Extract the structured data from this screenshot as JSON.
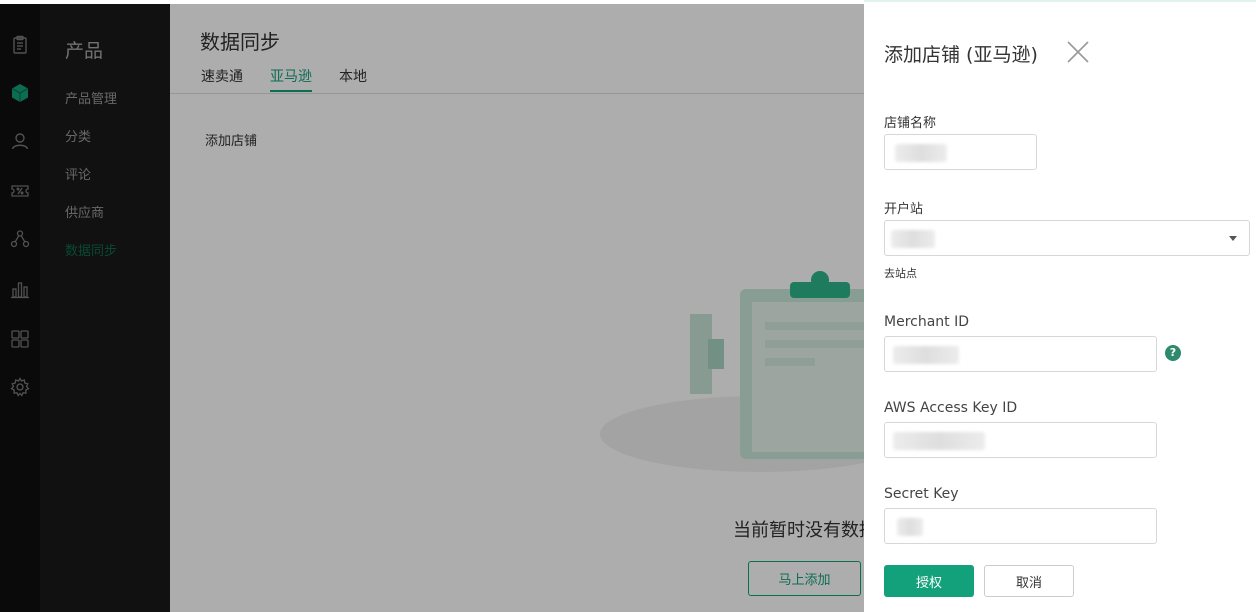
{
  "sidebar": {
    "title": "产品",
    "items": [
      {
        "label": "产品管理"
      },
      {
        "label": "分类"
      },
      {
        "label": "评论"
      },
      {
        "label": "供应商"
      },
      {
        "label": "数据同步",
        "active": true
      }
    ]
  },
  "rail": {
    "icons": [
      "clipboard-icon",
      "cube-icon",
      "user-icon",
      "discount-icon",
      "share-icon",
      "bar-chart-icon",
      "apps-icon",
      "settings-icon"
    ],
    "active_color": "#13a17b"
  },
  "main": {
    "title": "数据同步",
    "tabs": [
      {
        "label": "速卖通"
      },
      {
        "label": "亚马逊",
        "active": true
      },
      {
        "label": "本地"
      }
    ],
    "add_store_link": "添加店铺",
    "empty_text": "当前暂时没有数据",
    "add_now_button": "马上添加"
  },
  "drawer": {
    "title": "添加店铺 (亚马逊)",
    "fields": {
      "store_name": {
        "label": "店铺名称",
        "value": ""
      },
      "site": {
        "label": "开户站",
        "value": "",
        "link": "去站点"
      },
      "merchant_id": {
        "label": "Merchant ID",
        "value": "",
        "help": "?"
      },
      "aws_key": {
        "label": "AWS Access Key ID",
        "value": ""
      },
      "secret_key": {
        "label": "Secret Key",
        "value": ""
      }
    },
    "authorize_button": "授权",
    "cancel_button": "取消"
  },
  "colors": {
    "accent": "#13a17b",
    "sidebar_active": "#0c6b4c",
    "rail_bg": "#0f0f0f",
    "sidebar_bg": "#1a1a1a"
  }
}
